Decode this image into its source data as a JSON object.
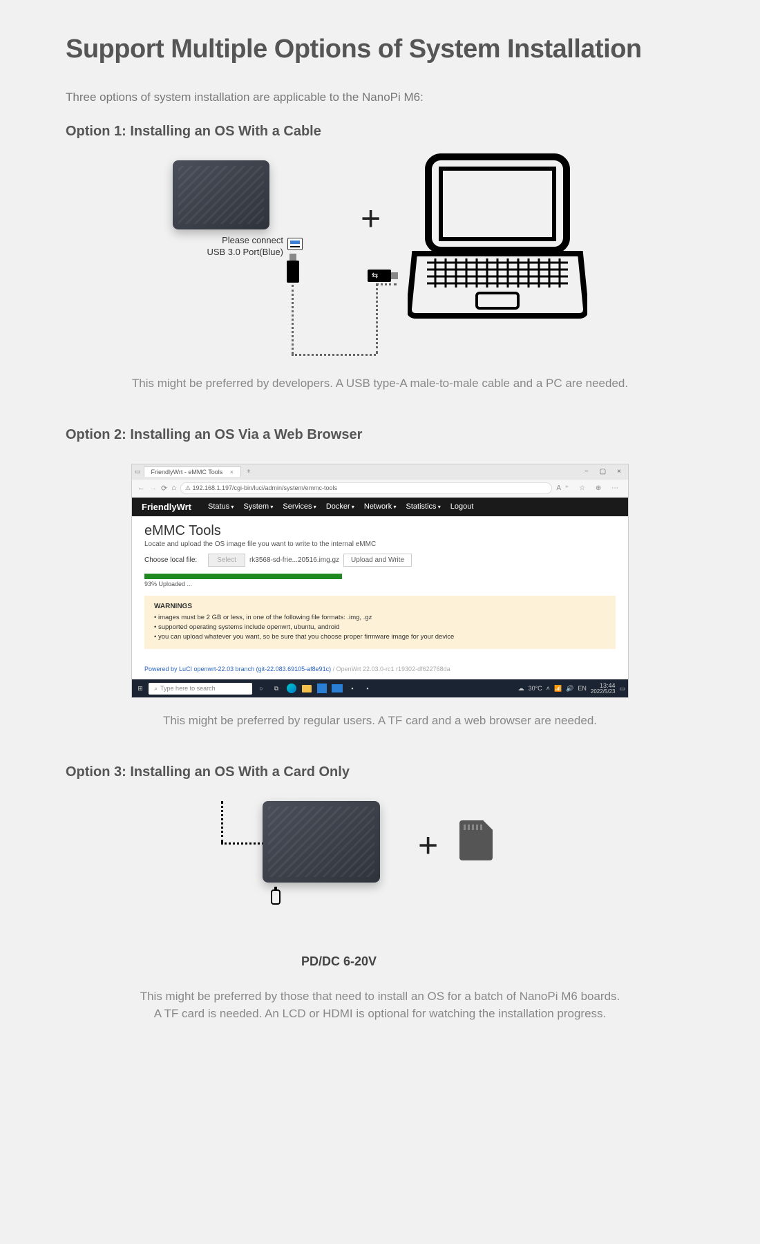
{
  "title": "Support Multiple Options of System Installation",
  "intro": "Three options of system installation are applicable to the NanoPi M6:",
  "option1": {
    "heading": "Option 1: Installing an OS With a Cable",
    "connect_line1": "Please connect",
    "connect_line2": "USB 3.0 Port(Blue)",
    "plus": "+",
    "caption": "This might be preferred by developers. A USB type-A male-to-male cable and a PC are needed."
  },
  "option2": {
    "heading": "Option 2: Installing an OS Via a Web Browser",
    "browser": {
      "tab_title": "FriendlyWrt - eMMC Tools",
      "url": "192.168.1.197/cgi-bin/luci/admin/system/emmc-tools",
      "brand": "FriendlyWrt",
      "menu": [
        "Status",
        "System",
        "Services",
        "Docker",
        "Network",
        "Statistics",
        "Logout"
      ],
      "page_title": "eMMC Tools",
      "subtitle": "Locate and upload the OS image file you want to write to the internal eMMC",
      "choose_label": "Choose local file:",
      "select_btn": "Select",
      "filename": "rk3568-sd-frie...20516.img.gz",
      "upload_btn": "Upload and Write",
      "progress_pct": 93,
      "progress_text": "93% Uploaded ...",
      "warn_title": "WARNINGS",
      "warn_items": [
        "images must be 2 GB or less, in one of the following file formats: .img, .gz",
        "supported operating systems include openwrt, ubuntu, android",
        "you can upload whatever you want, so be sure that you choose proper firmware image for your device"
      ],
      "footer_link": "Powered by LuCI openwrt-22.03 branch (git-22.083.69105-af8e91c)",
      "footer_grey": " / OpenWrt 22.03.0-rc1 r19302-df622768da",
      "taskbar": {
        "search_placeholder": "Type here to search",
        "weather": "30°C",
        "lang": "EN",
        "time": "13:44",
        "date": "2022/5/23"
      }
    },
    "caption": "This might be preferred by regular users. A TF card and a web browser are needed."
  },
  "option3": {
    "heading": "Option 3: Installing an OS With a Card Only",
    "plus": "+",
    "pd_label": "PD/DC 6-20V",
    "caption": "This might be preferred by those that need to install an OS for a batch of NanoPi M6 boards.\nA TF card is needed. An LCD or HDMI is optional for watching the installation progress."
  }
}
